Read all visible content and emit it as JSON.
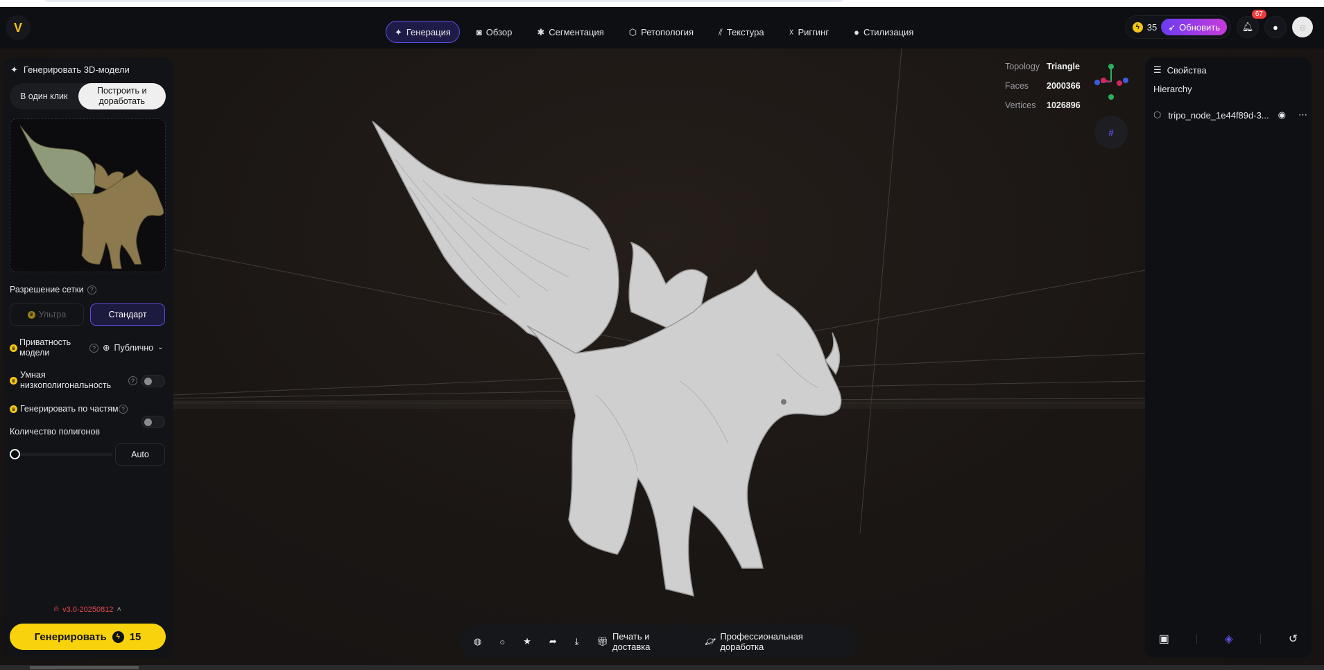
{
  "header": {
    "logo": "V",
    "nav": [
      {
        "label": "Генерация",
        "icon": "sparkle-icon",
        "active": true
      },
      {
        "label": "Обзор",
        "icon": "camera-frame-icon"
      },
      {
        "label": "Сегментация",
        "icon": "puzzle-icon"
      },
      {
        "label": "Ретопология",
        "icon": "mesh-icon"
      },
      {
        "label": "Текстура",
        "icon": "texture-icon"
      },
      {
        "label": "Риггинг",
        "icon": "figure-icon"
      },
      {
        "label": "Стилизация",
        "icon": "palette-icon"
      }
    ],
    "credits": "35",
    "upgrade_label": "Обновить",
    "notifications": "67"
  },
  "left_panel": {
    "title": "Генерировать 3D-модели",
    "mode_tabs": [
      "В один клик",
      "Построить и доработать"
    ],
    "mesh_resolution_label": "Разрешение сетки",
    "resolution_options": [
      "Ультра",
      "Стандарт"
    ],
    "privacy_label": "Приватность модели",
    "privacy_value": "Публично",
    "smart_lowpoly_label": "Умная низкополигональность",
    "parts_label": "Генерировать по частям",
    "polycount_label": "Количество полигонов",
    "polycount_value": "Auto",
    "polycount_slider": 0,
    "version": "v3.0-20250812",
    "generate_label": "Генерировать",
    "generate_cost": "15"
  },
  "viewport": {
    "stats": [
      {
        "key": "Topology",
        "value": "Triangle"
      },
      {
        "key": "Faces",
        "value": "2000366"
      },
      {
        "key": "Vertices",
        "value": "1026896"
      }
    ],
    "toolbar": {
      "print_label": "Печать и доставка",
      "pro_label": "Профессиональная доработка"
    }
  },
  "right_panel": {
    "title": "Свойства",
    "hierarchy_label": "Hierarchy",
    "node_name": "tripo_node_1e44f89d-3..."
  },
  "colors": {
    "accent": "#5a4fe0",
    "generate": "#f8d20c",
    "badge": "#ef3c3c",
    "version": "#e04848"
  }
}
